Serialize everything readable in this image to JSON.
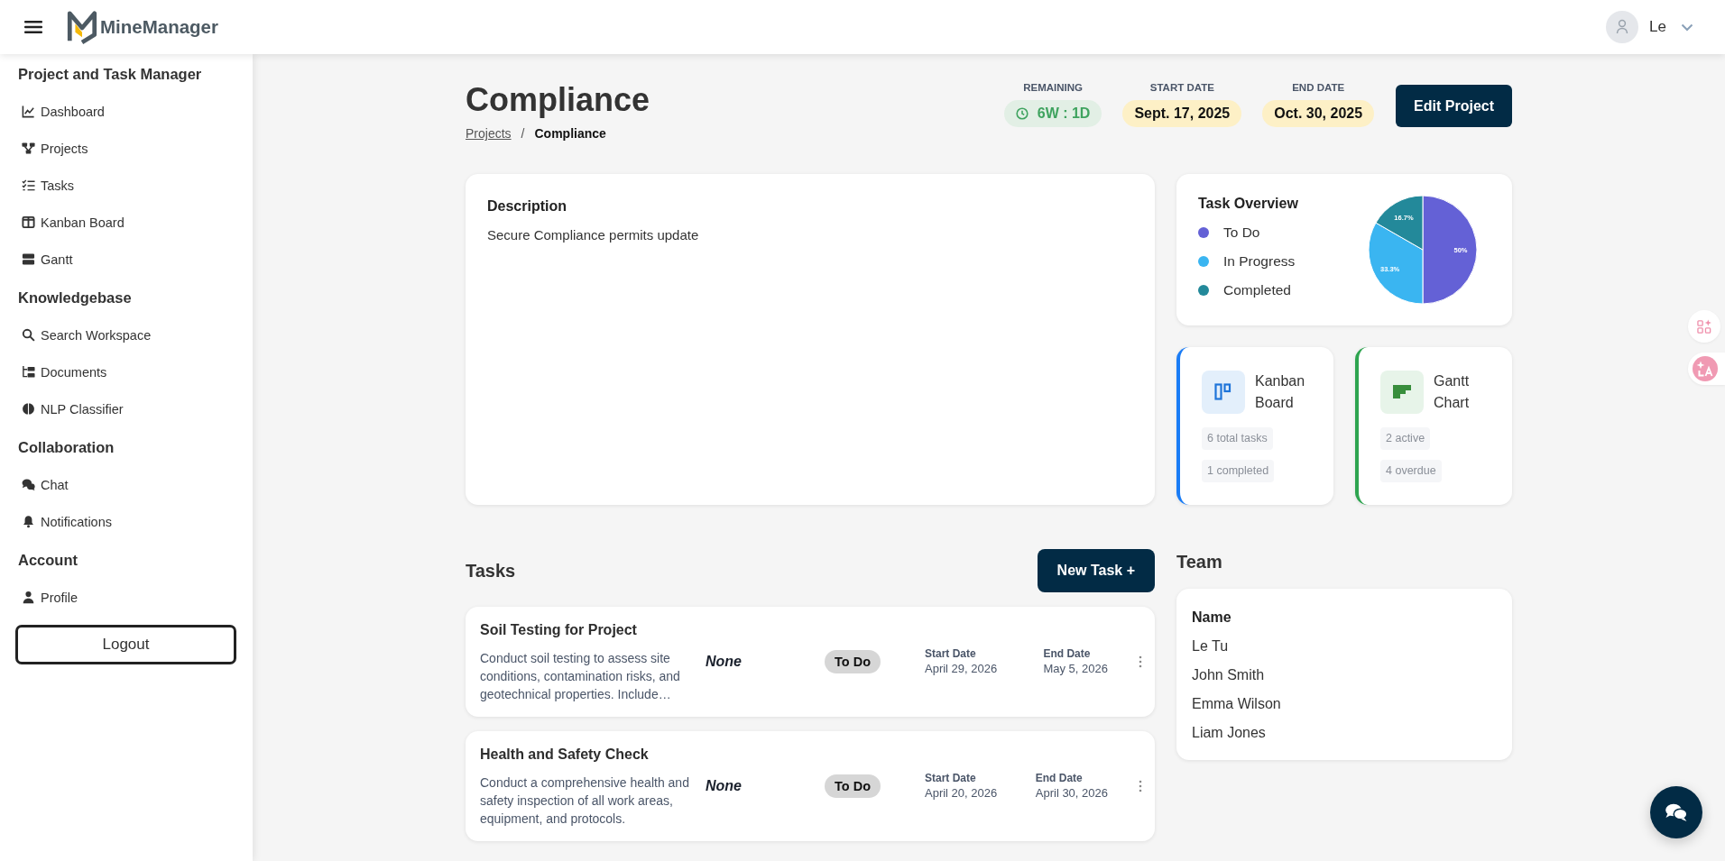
{
  "header": {
    "brand": "MineManager",
    "user_name": "Le"
  },
  "sidebar": {
    "sections": [
      {
        "title": "Project and Task Manager",
        "items": [
          "Dashboard",
          "Projects",
          "Tasks",
          "Kanban Board",
          "Gantt"
        ]
      },
      {
        "title": "Knowledgebase",
        "items": [
          "Search Workspace",
          "Documents",
          "NLP Classifier"
        ]
      },
      {
        "title": "Collaboration",
        "items": [
          "Chat",
          "Notifications"
        ]
      },
      {
        "title": "Account",
        "items": [
          "Profile"
        ]
      }
    ],
    "logout": "Logout"
  },
  "project": {
    "title": "Compliance",
    "breadcrumb": {
      "items": [
        {
          "label": "Projects",
          "kind": "link"
        },
        {
          "label": "Compliance",
          "kind": "current"
        }
      ],
      "separator": "/"
    },
    "stats": [
      {
        "label": "REMAINING",
        "value": "6W : 1D",
        "kind": "remaining"
      },
      {
        "label": "START DATE",
        "value": "Sept. 17, 2025",
        "kind": "date"
      },
      {
        "label": "END DATE",
        "value": "Oct. 30, 2025",
        "kind": "date"
      }
    ],
    "edit_button": "Edit Project"
  },
  "description": {
    "title": "Description",
    "text": "Secure Compliance permits update"
  },
  "task_overview": {
    "title": "Task Overview",
    "legend": [
      {
        "label": "To Do",
        "color": "#6461d6"
      },
      {
        "label": "In Progress",
        "color": "#3ab5f1"
      },
      {
        "label": "Completed",
        "color": "#23899a"
      }
    ],
    "chart_data": {
      "type": "pie",
      "values": [
        50,
        33.3,
        16.7
      ],
      "value_labels": [
        "50%",
        "33.3%",
        "16.7%"
      ]
    }
  },
  "quick_cards": [
    {
      "kind": "kanban",
      "title": "Kanban Board",
      "color": "#1a7cf5",
      "badges": [
        "6 total tasks",
        "1 completed"
      ]
    },
    {
      "kind": "gantt",
      "title": "Gantt Chart",
      "color": "#2ea44f",
      "badges": [
        "2 active",
        "4 overdue"
      ]
    }
  ],
  "tasks": {
    "title": "Tasks",
    "new_button": "New Task +",
    "items": [
      {
        "title": "Soil Testing for Project",
        "description": "Conduct soil testing to assess site conditions, contamination risks, and geotechnical properties. Include…",
        "column_2": "None",
        "status": "To Do",
        "start_label": "Start Date",
        "start": "April 29, 2026",
        "end_label": "End Date",
        "end": "May 5, 2026"
      },
      {
        "title": "Health and Safety Check",
        "description": "Conduct a comprehensive health and safety inspection of all work areas, equipment, and protocols.",
        "column_2": "None",
        "status": "To Do",
        "start_label": "Start Date",
        "start": "April 20, 2026",
        "end_label": "End Date",
        "end": "April 30, 2026"
      }
    ]
  },
  "team": {
    "title": "Team",
    "column": "Name",
    "members": [
      "Le Tu",
      "John Smith",
      "Emma Wilson",
      "Liam Jones"
    ]
  }
}
